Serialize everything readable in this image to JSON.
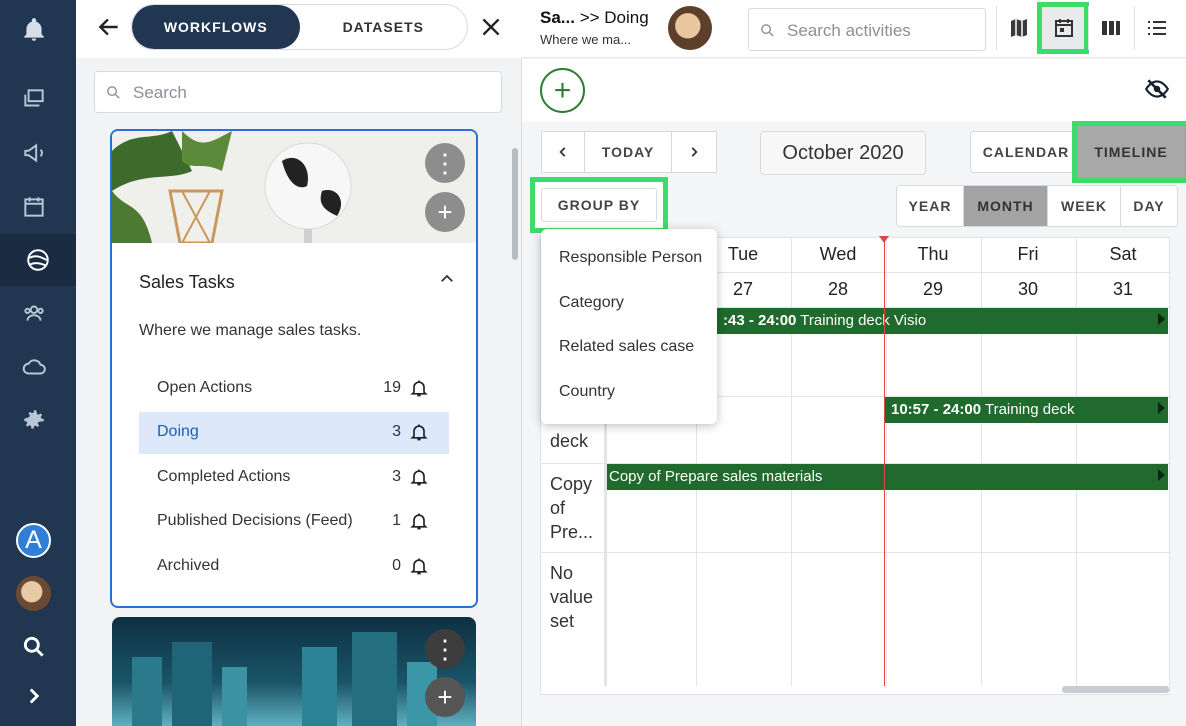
{
  "left_panel": {
    "tabs": [
      "WORKFLOWS",
      "DATASETS"
    ],
    "search_placeholder": "Search",
    "card": {
      "title": "Sales Tasks",
      "description": "Where we manage sales tasks.",
      "rows": [
        {
          "label": "Open Actions",
          "count": "19"
        },
        {
          "label": "Doing",
          "count": "3"
        },
        {
          "label": "Completed Actions",
          "count": "3"
        },
        {
          "label": "Published Decisions (Feed)",
          "count": "1"
        },
        {
          "label": "Archived",
          "count": "0"
        }
      ]
    }
  },
  "header": {
    "title_short": "Sa...",
    "breadcrumb": ">> Doing",
    "subtitle": "Where we ma...",
    "search_placeholder": "Search activities"
  },
  "toolbar": {
    "today": "TODAY",
    "month_label": "October 2020",
    "calendar": "CALENDAR",
    "timeline": "TIMELINE",
    "group_by": "GROUP BY",
    "ranges": [
      "YEAR",
      "MONTH",
      "WEEK",
      "DAY"
    ]
  },
  "group_by_menu": [
    "Responsible Person",
    "Category",
    "Related sales case",
    "Country"
  ],
  "timeline": {
    "days": [
      {
        "name": "Tue",
        "num": "27"
      },
      {
        "name": "Wed",
        "num": "28"
      },
      {
        "name": "Thu",
        "num": "29"
      },
      {
        "name": "Fri",
        "num": "30"
      },
      {
        "name": "Sat",
        "num": "31"
      }
    ],
    "row_labels": [
      "deck",
      "Copy of Pre...",
      "No value set"
    ],
    "events": [
      {
        "time": ":43 - 24:00",
        "name": "Training deck Visio"
      },
      {
        "time": "10:57 - 24:00",
        "name": "Training deck"
      },
      {
        "time": "",
        "name": "Copy of Prepare sales materials"
      }
    ]
  },
  "colors": {
    "rail": "#213650",
    "accent_green": "#3ddc6a",
    "event_bar": "#1f6a2c",
    "selected_row": "#dde8fb"
  }
}
